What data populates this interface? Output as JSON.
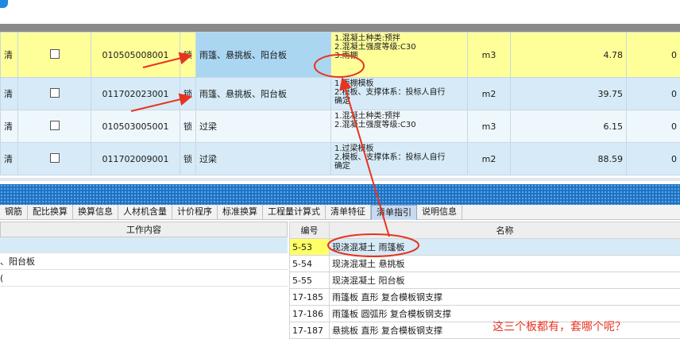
{
  "window": {
    "title": ""
  },
  "colors": {
    "annotation": "#e8331f",
    "selected_row": "#ffff99",
    "accent": "#1e6fc0"
  },
  "grid": {
    "rows": [
      {
        "type_label": "清",
        "code": "010505008001",
        "lock": "锁",
        "name": "雨篷、悬挑板、阳台板",
        "description": "1.混凝土种类:预拌\n2.混凝土强度等级:C30\n3.雨棚",
        "unit": "m3",
        "quantity": "4.78",
        "extra": "0"
      },
      {
        "type_label": "清",
        "code": "011702023001",
        "lock": "锁",
        "name": "雨篷、悬挑板、阳台板",
        "description": "1.雨棚模板\n2.模板、支撑体系：投标人自行\n确定",
        "unit": "m2",
        "quantity": "39.75",
        "extra": "0"
      },
      {
        "type_label": "清",
        "code": "010503005001",
        "lock": "锁",
        "name": "过梁",
        "description": "1.混凝土种类:预拌\n2.混凝土强度等级:C30",
        "unit": "m3",
        "quantity": "6.15",
        "extra": "0"
      },
      {
        "type_label": "清",
        "code": "011702009001",
        "lock": "锁",
        "name": "过梁",
        "description": "1.过梁模板\n2.模板、支撑体系：投标人自行\n确定",
        "unit": "m2",
        "quantity": "88.59",
        "extra": "0"
      }
    ]
  },
  "tabs": [
    {
      "label": "钢筋"
    },
    {
      "label": "配比换算"
    },
    {
      "label": "换算信息"
    },
    {
      "label": "人材机含量"
    },
    {
      "label": "计价程序"
    },
    {
      "label": "标准换算"
    },
    {
      "label": "工程量计算式"
    },
    {
      "label": "清单特征"
    },
    {
      "label": "清单指引",
      "active": true
    },
    {
      "label": "说明信息"
    }
  ],
  "work_content": {
    "header": "工作内容",
    "items": [
      "",
      "、阳台板",
      "("
    ]
  },
  "guide_table": {
    "headers": {
      "code": "编号",
      "name": "名称"
    },
    "rows": [
      {
        "code": "5-53",
        "name": "现浇混凝土 雨篷板"
      },
      {
        "code": "5-54",
        "name": "现浇混凝土 悬挑板"
      },
      {
        "code": "5-55",
        "name": "现浇混凝土 阳台板"
      },
      {
        "code": "17-185",
        "name": "雨篷板 直形 复合模板钢支撑"
      },
      {
        "code": "17-186",
        "name": "雨篷板 圆弧形 复合模板钢支撑"
      },
      {
        "code": "17-187",
        "name": "悬挑板 直形 复合模板钢支撑"
      }
    ]
  },
  "annotation": {
    "text": "这三个板都有，套哪个呢？"
  }
}
